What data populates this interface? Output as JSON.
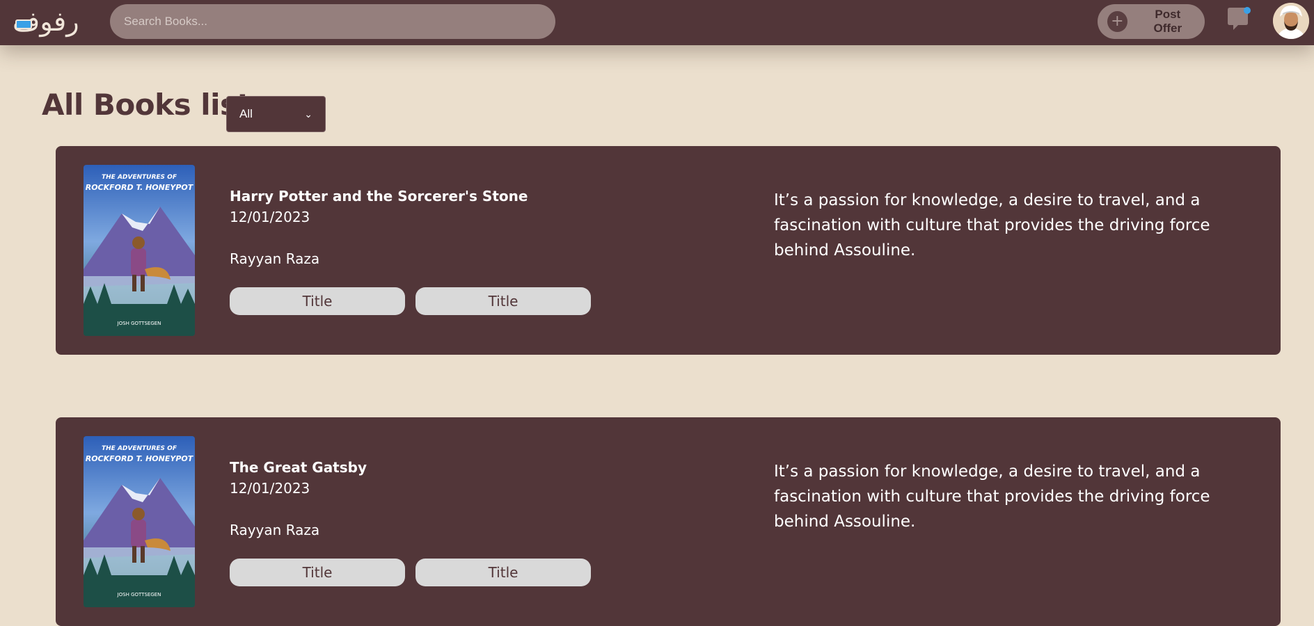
{
  "header": {
    "logo_text": "رفوف",
    "search": {
      "placeholder": "Search Books..."
    },
    "post_offer": {
      "icon": "plus-icon",
      "label": "Post Offer"
    },
    "chat_icon": "chat-bubble-icon",
    "avatar": "user-avatar"
  },
  "page": {
    "title": "All Books list",
    "filter": {
      "selected": "All"
    }
  },
  "books": [
    {
      "title": "Harry Potter and the Sorcerer's Stone",
      "date": "12/01/2023",
      "author": "Rayyan Raza",
      "buttons": [
        "Title",
        "Title"
      ],
      "description": "It’s a passion for knowledge, a desire to travel, and a fascination with culture that provides the driving force behind Assouline.",
      "cover": {
        "series": "THE ADVENTURES OF",
        "title": "ROCKFORD T. HONEYPOT",
        "author": "JOSH GOTTSEGEN"
      }
    },
    {
      "title": "The Great Gatsby",
      "date": "12/01/2023",
      "author": "Rayyan Raza",
      "buttons": [
        "Title",
        "Title"
      ],
      "description": "It’s a passion for knowledge, a desire to travel, and a fascination with culture that provides the driving force behind Assouline.",
      "cover": {
        "series": "THE ADVENTURES OF",
        "title": "ROCKFORD T. HONEYPOT",
        "author": "JOSH GOTTSEGEN"
      }
    }
  ],
  "colors": {
    "background": "#ebdfcd",
    "primary": "#523639",
    "header_control": "#957f7d",
    "pill": "#d9d9d9",
    "notification_dot": "#3aa0e6"
  }
}
